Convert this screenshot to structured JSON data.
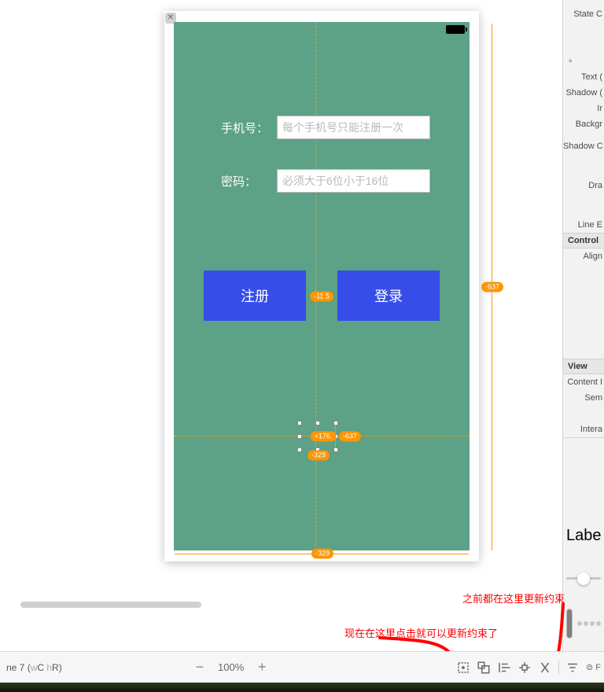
{
  "form": {
    "phone_label": "手机号：",
    "phone_placeholder": "每个手机号只能注册一次",
    "pass_label": "密码：",
    "pass_placeholder": "必须大于6位小于16位"
  },
  "buttons": {
    "register": "注册",
    "login": "登录"
  },
  "constraints": {
    "btn_gap": "-11.5",
    "right_h": "-637",
    "sel_x": "+176.",
    "sel_right": "-637",
    "sel_bottom": "-329",
    "canvas_bottom": "-329"
  },
  "inspector": {
    "state_config": "State C",
    "text_color": "Text (",
    "shadow1": "Shadow (",
    "image": "Ir",
    "background": "Backgr",
    "shadow_off": "Shadow C",
    "drawing": "Dra",
    "line_break": "Line E",
    "control_header": "Control",
    "alignment": "Align",
    "view_header": "View",
    "content_mode": "Content I",
    "semantic": "Sem",
    "intera": "Intera",
    "label_field": "Label",
    "flags": "⊜ F"
  },
  "annotations": {
    "prev": "之前都在这里更新约束",
    "now": "现在在这里点击就可以更新约束了"
  },
  "bottombar": {
    "device_prefix": "ne 7 (",
    "device_w": "w",
    "device_c": "C ",
    "device_h": "h",
    "device_r": "R",
    "device_suffix": ")",
    "zoom": "100%"
  }
}
